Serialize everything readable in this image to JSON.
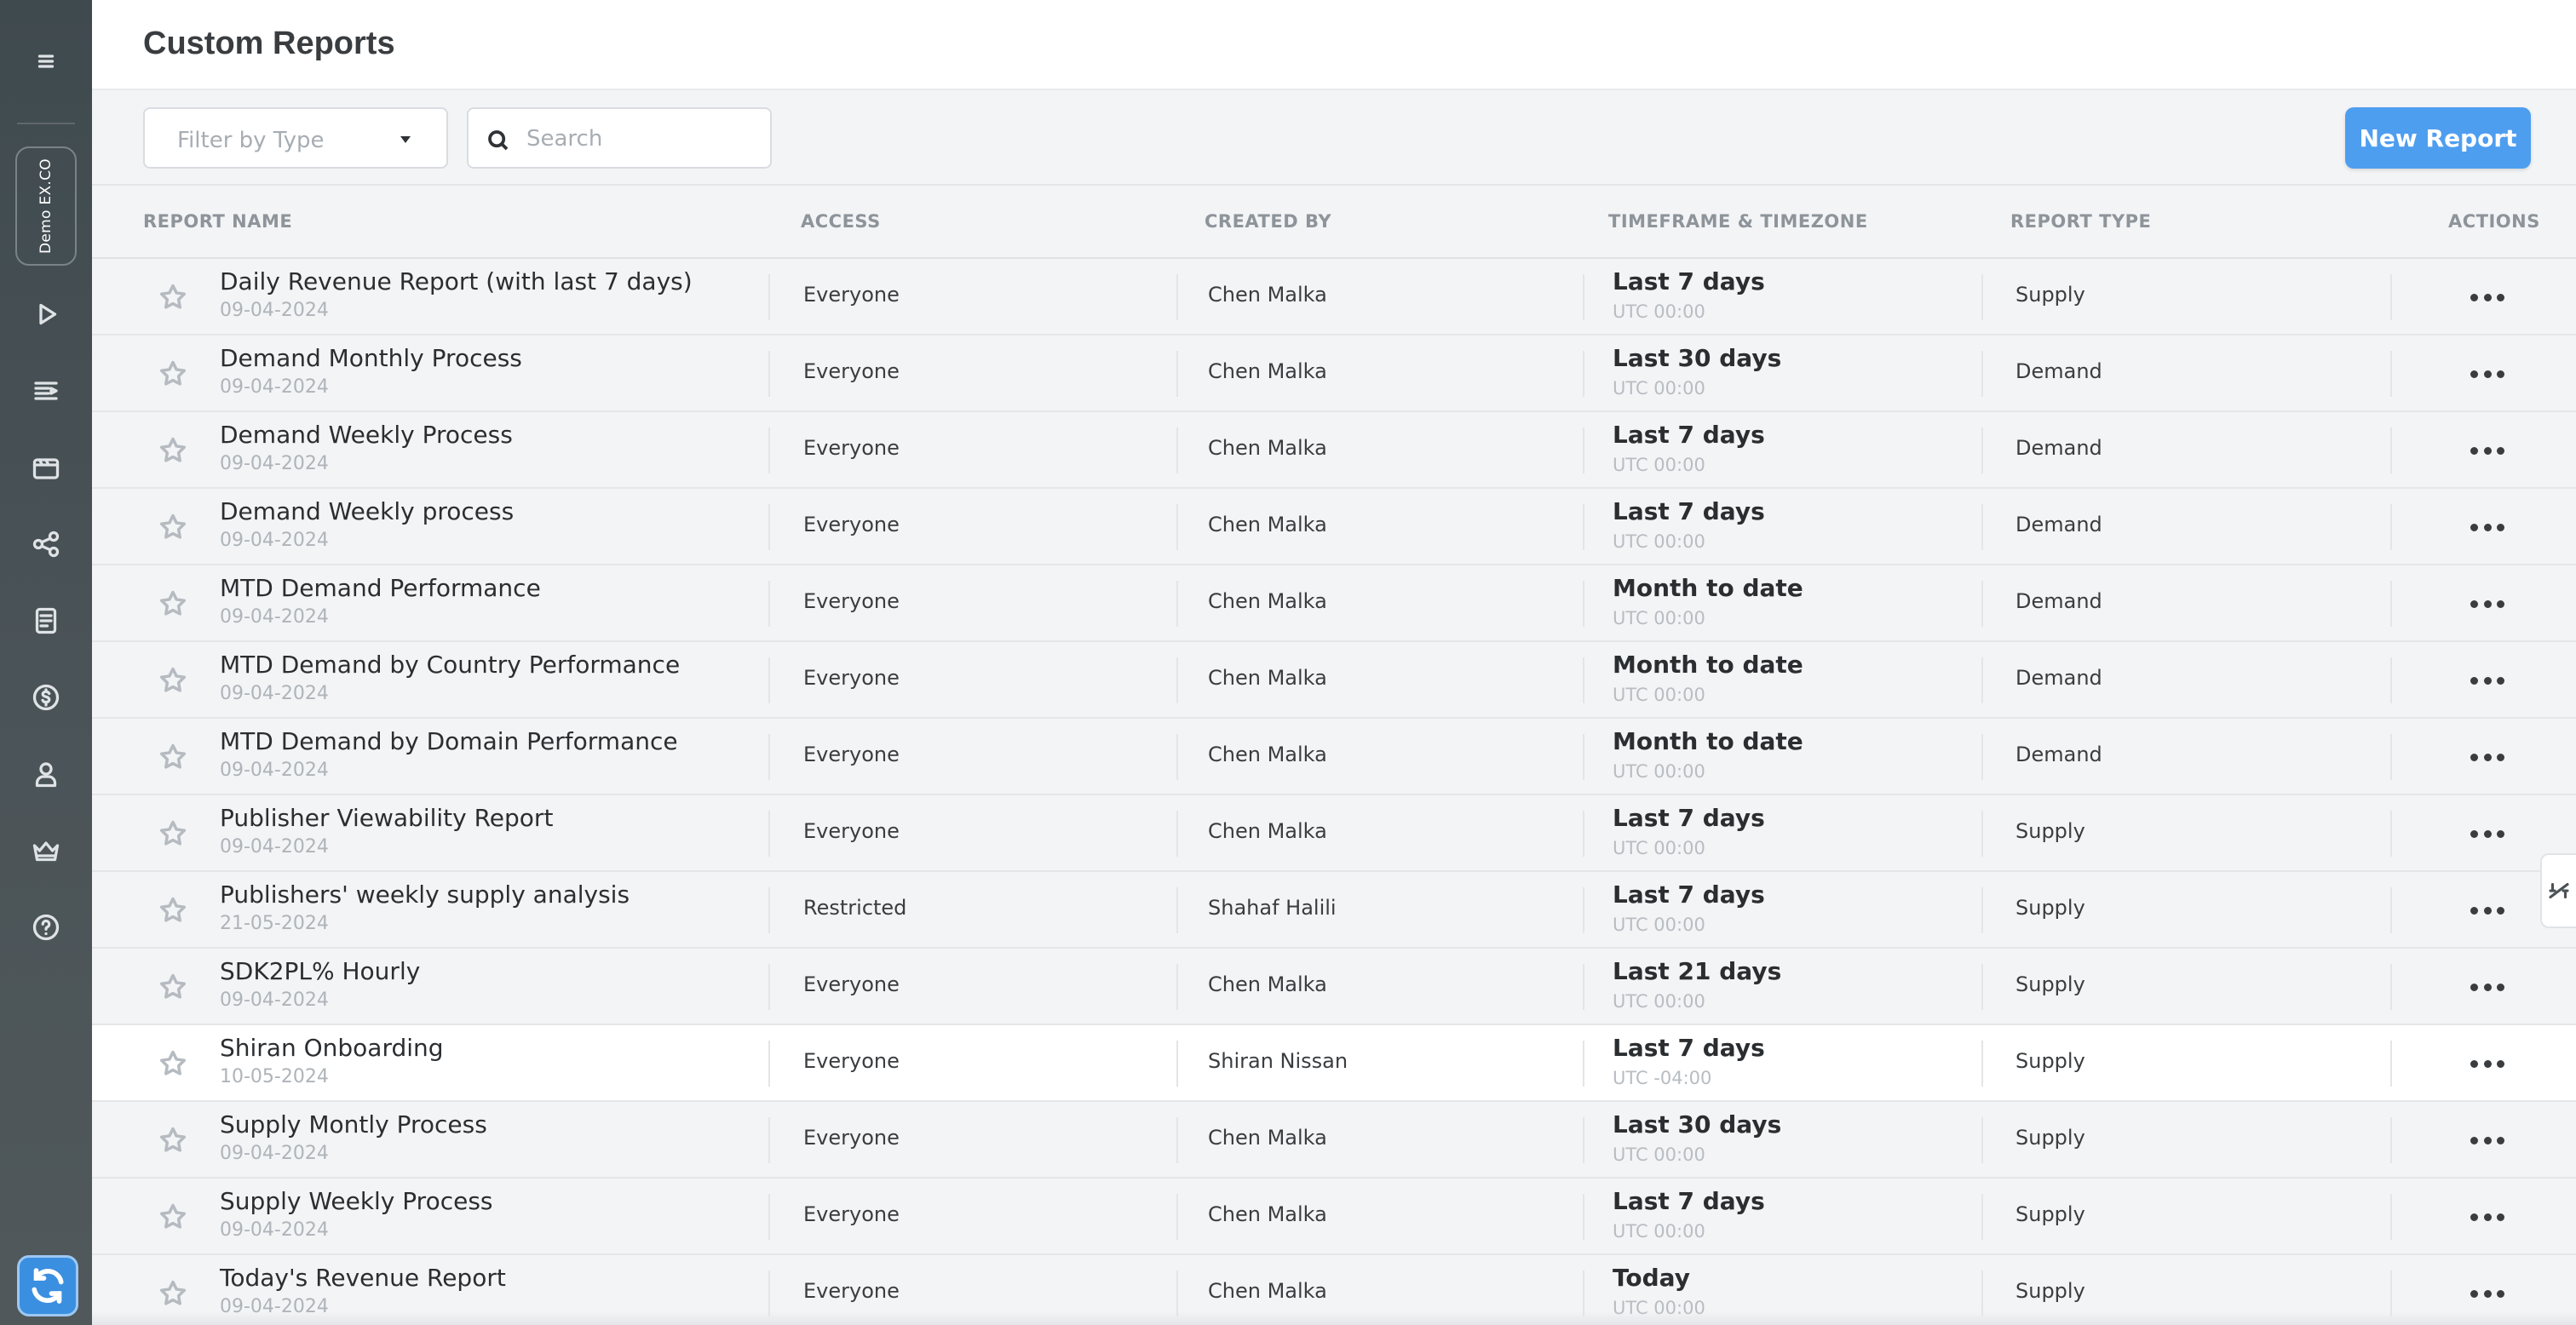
{
  "sidebar": {
    "org_label": "Demo EX.CO",
    "icons": [
      "menu-icon",
      "play-icon",
      "playlist-icon",
      "media-icon",
      "share-icon",
      "reports-icon",
      "dollar-icon",
      "user-icon",
      "crown-icon",
      "help-icon",
      "sync-icon"
    ]
  },
  "header": {
    "title": "Custom Reports"
  },
  "toolbar": {
    "filter_placeholder": "Filter by Type",
    "search_placeholder": "Search",
    "new_report_label": "New Report"
  },
  "table": {
    "columns": {
      "name": "REPORT NAME",
      "access": "ACCESS",
      "created_by": "CREATED BY",
      "timeframe": "TIMEFRAME & TIMEZONE",
      "type": "REPORT TYPE",
      "actions": "ACTIONS"
    },
    "rows": [
      {
        "name": "Daily Revenue Report (with last 7 days)",
        "date": "09-04-2024",
        "access": "Everyone",
        "created_by": "Chen Malka",
        "timeframe": "Last 7 days",
        "timezone": "UTC 00:00",
        "type": "Supply"
      },
      {
        "name": "Demand Monthly Process",
        "date": "09-04-2024",
        "access": "Everyone",
        "created_by": "Chen Malka",
        "timeframe": "Last 30 days",
        "timezone": "UTC 00:00",
        "type": "Demand"
      },
      {
        "name": "Demand Weekly Process",
        "date": "09-04-2024",
        "access": "Everyone",
        "created_by": "Chen Malka",
        "timeframe": "Last 7 days",
        "timezone": "UTC 00:00",
        "type": "Demand"
      },
      {
        "name": "Demand Weekly process",
        "date": "09-04-2024",
        "access": "Everyone",
        "created_by": "Chen Malka",
        "timeframe": "Last 7 days",
        "timezone": "UTC 00:00",
        "type": "Demand"
      },
      {
        "name": "MTD Demand Performance",
        "date": "09-04-2024",
        "access": "Everyone",
        "created_by": "Chen Malka",
        "timeframe": "Month to date",
        "timezone": "UTC 00:00",
        "type": "Demand"
      },
      {
        "name": "MTD Demand by Country Performance",
        "date": "09-04-2024",
        "access": "Everyone",
        "created_by": "Chen Malka",
        "timeframe": "Month to date",
        "timezone": "UTC 00:00",
        "type": "Demand"
      },
      {
        "name": "MTD Demand by Domain Performance",
        "date": "09-04-2024",
        "access": "Everyone",
        "created_by": "Chen Malka",
        "timeframe": "Month to date",
        "timezone": "UTC 00:00",
        "type": "Demand"
      },
      {
        "name": "Publisher Viewability Report",
        "date": "09-04-2024",
        "access": "Everyone",
        "created_by": "Chen Malka",
        "timeframe": "Last 7 days",
        "timezone": "UTC 00:00",
        "type": "Supply"
      },
      {
        "name": "Publishers' weekly supply analysis",
        "date": "21-05-2024",
        "access": "Restricted",
        "created_by": "Shahaf Halili",
        "timeframe": "Last 7 days",
        "timezone": "UTC 00:00",
        "type": "Supply"
      },
      {
        "name": "SDK2PL% Hourly",
        "date": "09-04-2024",
        "access": "Everyone",
        "created_by": "Chen Malka",
        "timeframe": "Last 21 days",
        "timezone": "UTC 00:00",
        "type": "Supply"
      },
      {
        "name": "Shiran Onboarding",
        "date": "10-05-2024",
        "access": "Everyone",
        "created_by": "Shiran Nissan",
        "timeframe": "Last 7 days",
        "timezone": "UTC -04:00",
        "type": "Supply",
        "highlighted": true
      },
      {
        "name": "Supply Montly Process",
        "date": "09-04-2024",
        "access": "Everyone",
        "created_by": "Chen Malka",
        "timeframe": "Last 30 days",
        "timezone": "UTC 00:00",
        "type": "Supply"
      },
      {
        "name": "Supply Weekly Process",
        "date": "09-04-2024",
        "access": "Everyone",
        "created_by": "Chen Malka",
        "timeframe": "Last 7 days",
        "timezone": "UTC 00:00",
        "type": "Supply"
      },
      {
        "name": "Today's Revenue Report",
        "date": "09-04-2024",
        "access": "Everyone",
        "created_by": "Chen Malka",
        "timeframe": "Today",
        "timezone": "UTC 00:00",
        "type": "Supply"
      }
    ]
  }
}
